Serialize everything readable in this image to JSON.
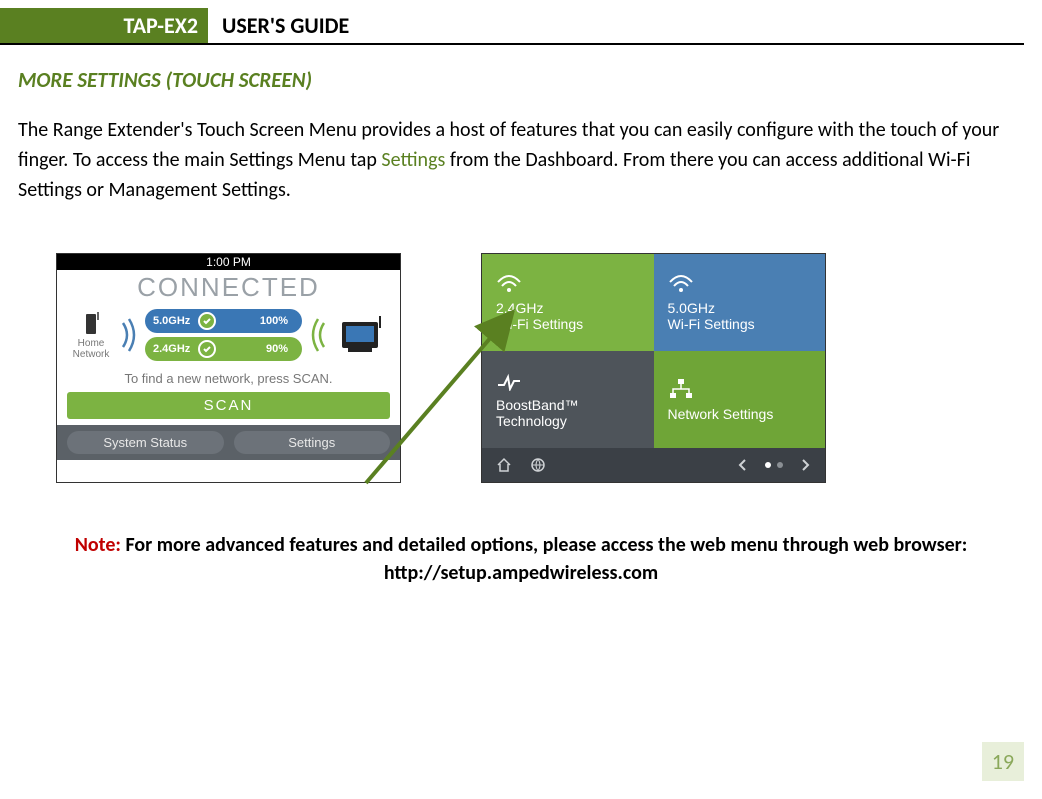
{
  "header": {
    "badge": "TAP-EX2",
    "title": "USER'S GUIDE"
  },
  "section_title": "MORE SETTINGS (TOUCH SCREEN)",
  "body": {
    "part1": "The Range Extender's Touch Screen Menu provides a host of features that you can easily configure with the touch of your finger. To access the main Settings Menu tap ",
    "settings_word": "Settings",
    "part2": " from the Dashboard. From there you can access additional Wi-Fi Settings or Management Settings."
  },
  "screen1": {
    "time": "1:00 PM",
    "status": "CONNECTED",
    "home_label": "Home Network",
    "band5": "5.0GHz",
    "pct5": "100%",
    "band24": "2.4GHz",
    "pct24": "90%",
    "find_text": "To find a new network, press SCAN.",
    "scan": "SCAN",
    "btn_status": "System Status",
    "btn_settings": "Settings"
  },
  "screen2": {
    "tile1a": "2.4GHz",
    "tile1b": "Wi-Fi Settings",
    "tile2a": "5.0GHz",
    "tile2b": "Wi-Fi Settings",
    "tile3a": "BoostBand™",
    "tile3b": "Technology",
    "tile4": "Network Settings"
  },
  "note": {
    "label": "Note:",
    "text": " For more advanced features and detailed options, please access the web menu through web browser: http://setup.ampedwireless.com"
  },
  "page_number": "19"
}
